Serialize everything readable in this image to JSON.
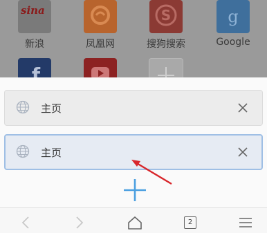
{
  "shortcuts": {
    "row1": [
      {
        "label": "新浪",
        "icon": "sina-logo-icon"
      },
      {
        "label": "凤凰网",
        "icon": "fenghuang-logo-icon"
      },
      {
        "label": "搜狗搜索",
        "icon": "sogou-logo-icon"
      },
      {
        "label": "Google",
        "icon": "google-logo-icon"
      }
    ],
    "row2": [
      {
        "icon": "facebook-logo-icon"
      },
      {
        "icon": "youtube-logo-icon"
      },
      {
        "icon": "add-shortcut-icon"
      }
    ],
    "sina_logo_text": "sina"
  },
  "tabs": [
    {
      "title": "主页",
      "active": false
    },
    {
      "title": "主页",
      "active": true
    }
  ],
  "bottom_nav": {
    "tab_count": "2",
    "items": [
      "back-icon",
      "forward-icon",
      "home-icon",
      "tabs-counter",
      "menu-icon"
    ]
  },
  "colors": {
    "active_tab_border": "#9fbfe5",
    "add_tab_blue": "#4a9fe0",
    "arrow_red": "#d8262b"
  }
}
